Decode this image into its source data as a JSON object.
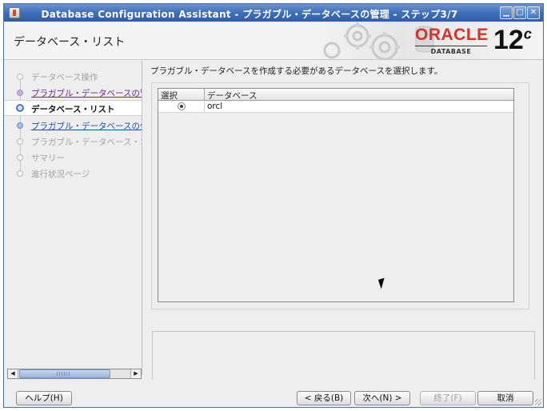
{
  "window": {
    "title": "Database Configuration Assistant - プラガブル・データベースの管理 - ステップ3/7",
    "min_glyph": "▁",
    "max_glyph": "□",
    "close_glyph": "✕"
  },
  "header": {
    "page_title": "データベース・リスト",
    "logo_text": "ORACLE",
    "logo_sub": "DATABASE",
    "version": "12",
    "version_sup": "c"
  },
  "steps": [
    {
      "label": "データベース操作",
      "state": "todo"
    },
    {
      "label": "プラガブル・データベースの管",
      "state": "done"
    },
    {
      "label": "データベース・リスト",
      "state": "current"
    },
    {
      "label": "プラガブル・データベースの作",
      "state": "next"
    },
    {
      "label": "プラガブル・データベース・オ",
      "state": "todo"
    },
    {
      "label": "サマリー",
      "state": "todo"
    },
    {
      "label": "進行状況ページ",
      "state": "todo"
    }
  ],
  "content": {
    "instruction": "プラガブル・データベースを作成する必要があるデータベースを選択します。",
    "table": {
      "columns": [
        "選択",
        "データベース"
      ],
      "rows": [
        {
          "selected": true,
          "database": "orcl"
        }
      ]
    }
  },
  "footer": {
    "help": "ヘルプ(H)",
    "back": "< 戻る(B)",
    "next": "次へ(N) >",
    "finish": "終了(F)",
    "cancel": "取消"
  },
  "scrollbar": {
    "left_glyph": "◀",
    "right_glyph": "▶"
  },
  "colors": {
    "title_bar": "#3f6fb8",
    "oracle_red": "#d3332a",
    "visited_step": "#6a2a8a",
    "next_step": "#1f4f99"
  }
}
